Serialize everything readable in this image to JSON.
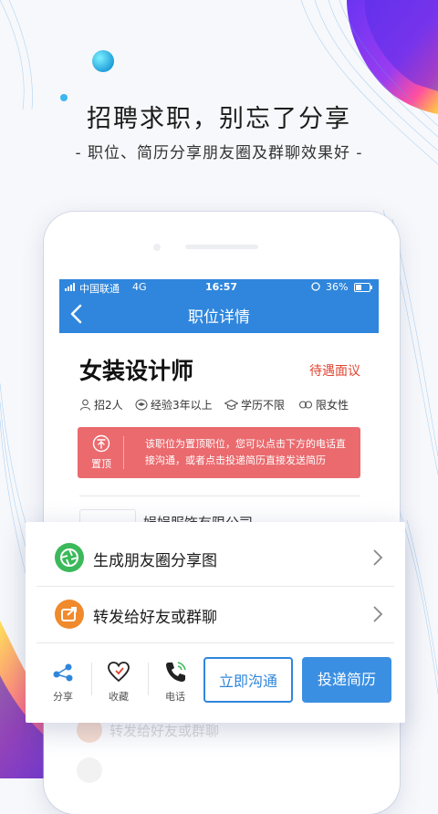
{
  "banner": {
    "headline": "招聘求职，别忘了分享",
    "subline": "- 职位、简历分享朋友圈及群聊效果好 -"
  },
  "status_bar": {
    "carrier": "中国联通",
    "network": "4G",
    "time": "16:57",
    "battery": "36%"
  },
  "nav": {
    "title": "职位详情",
    "back_icon": "chevron-left-icon"
  },
  "job": {
    "title": "女装设计师",
    "salary": "待遇面议",
    "tags": [
      {
        "icon": "person-icon",
        "text": "招2人"
      },
      {
        "icon": "experience-icon",
        "text": "经验3年以上"
      },
      {
        "icon": "graduation-cap-icon",
        "text": "学历不限"
      },
      {
        "icon": "gender-icon",
        "text": "限女性"
      }
    ],
    "notice": {
      "pin_label": "置顶",
      "message": "该职位为置顶职位，您可以点击下方的电话直接沟通，或者点击投递简历直接发送简历"
    },
    "company": "娟娟服饰有限公司"
  },
  "share_sheet": {
    "items": [
      {
        "icon": "camera-shutter-icon",
        "label": "生成朋友圈分享图",
        "color": "#3cb95b"
      },
      {
        "icon": "forward-icon",
        "label": "转发给好友或群聊",
        "color": "#f08a2c"
      }
    ]
  },
  "actions": {
    "share": "分享",
    "favorite": "收藏",
    "phone": "电话",
    "chat_button": "立即沟通",
    "apply_button": "投递简历"
  },
  "ghost_row": "转发给好友或群聊",
  "colors": {
    "accent": "#2f86dc",
    "notice": "#ea6a6e",
    "salary": "#e0432f"
  }
}
